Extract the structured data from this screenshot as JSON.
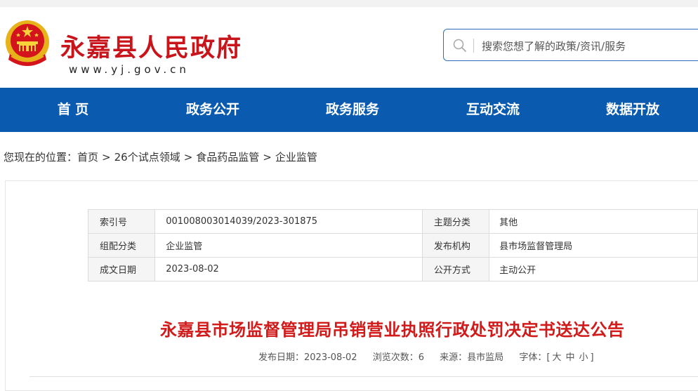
{
  "header": {
    "site_title": "永嘉县人民政府",
    "site_domain": "www.yj.gov.cn",
    "emblem_icon": "national-emblem-icon",
    "search_placeholder": "搜索您想了解的政策/资讯/服务"
  },
  "nav": {
    "items": [
      "首 页",
      "政务公开",
      "政务服务",
      "互动交流",
      "数据开放"
    ],
    "background_color": "#0a5bb0"
  },
  "breadcrumb": {
    "prefix": "您现在的位置：",
    "items": [
      "首页",
      "26个试点领域",
      "食品药品监管",
      "企业监管"
    ],
    "separator": ">"
  },
  "meta_table": {
    "rows": [
      {
        "label1": "索引号",
        "value1": "001008003014039/2023-301875",
        "label2": "主题分类",
        "value2": "其他"
      },
      {
        "label1": "组配分类",
        "value1": "企业监管",
        "label2": "发布机构",
        "value2": "县市场监督管理局"
      },
      {
        "label1": "成文日期",
        "value1": "2023-08-02",
        "label2": "公开方式",
        "value2": "主动公开"
      }
    ]
  },
  "article": {
    "title": "永嘉县市场监督管理局吊销营业执照行政处罚决定书送达公告",
    "title_color": "#d11a1a",
    "publish_label": "发布日期：",
    "publish_date": "2023-08-02",
    "views_label": "浏览次数：",
    "views": "6",
    "source_label": "来源：",
    "source": "县市监局",
    "font_label": "字体：",
    "font_open": "[",
    "font_large": "大",
    "font_medium": "中",
    "font_small": "小",
    "font_close": "]"
  }
}
